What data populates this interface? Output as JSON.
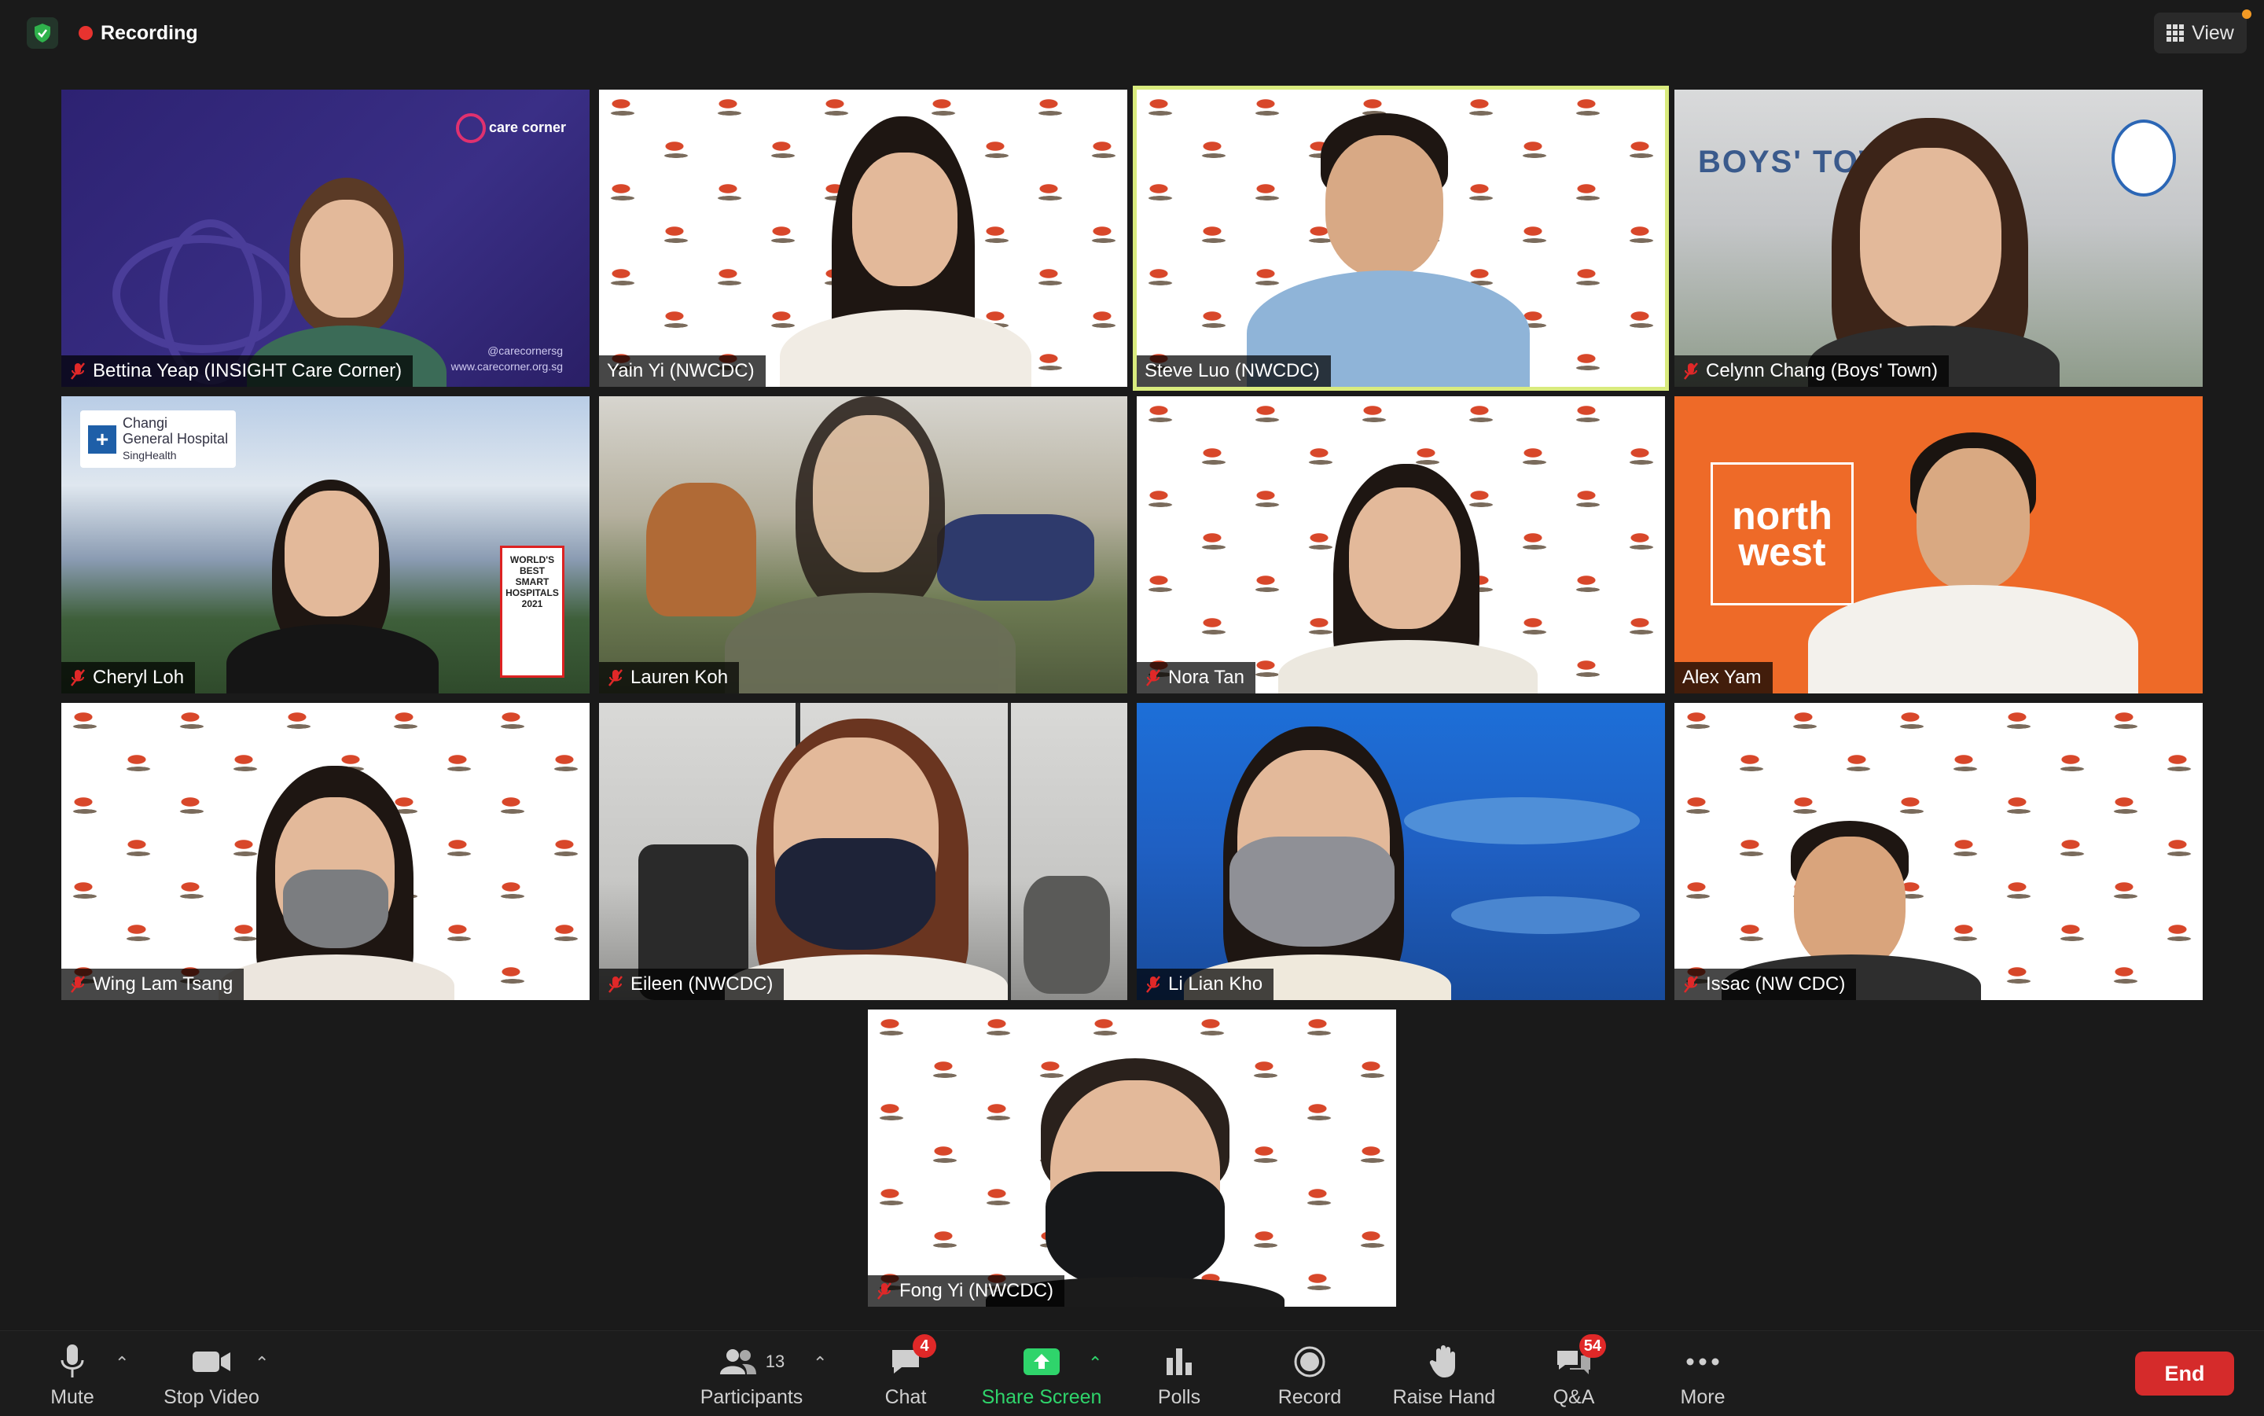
{
  "top_bar": {
    "recording_label": "Recording",
    "view_label": "View"
  },
  "participants_tiles": [
    {
      "name": "Bettina Yeap (INSIGHT Care Corner)",
      "muted": true
    },
    {
      "name": "Yain Yi (NWCDC)",
      "muted": false
    },
    {
      "name": "Steve Luo (NWCDC)",
      "muted": false,
      "active_speaker": true
    },
    {
      "name": "Celynn Chang (Boys' Town)",
      "muted": true
    },
    {
      "name": "Cheryl Loh",
      "muted": true
    },
    {
      "name": "Lauren Koh",
      "muted": true
    },
    {
      "name": "Nora Tan",
      "muted": true
    },
    {
      "name": "Alex Yam",
      "muted": false
    },
    {
      "name": "Wing Lam Tsang",
      "muted": true
    },
    {
      "name": "Eileen (NWCDC)",
      "muted": true
    },
    {
      "name": "Li Lian Kho",
      "muted": true
    },
    {
      "name": "Issac (NW CDC)",
      "muted": true
    },
    {
      "name": "Fong Yi (NWCDC)",
      "muted": true
    }
  ],
  "backgrounds": {
    "care_corner_logo": "care corner",
    "care_corner_social": "@carecornersg",
    "care_corner_url": "www.carecorner.org.sg",
    "northwest_logo_line1": "north",
    "northwest_logo_line2": "west",
    "changi_logo_line1": "Changi",
    "changi_logo_line2": "General Hospital",
    "changi_logo_line3": "SingHealth",
    "changi_badge": "WORLD'S BEST SMART HOSPITALS 2021",
    "boys_town_sign": "BOYS' TOWN"
  },
  "toolbar": {
    "mute_label": "Mute",
    "video_label": "Stop Video",
    "participants_label": "Participants",
    "participants_count": "13",
    "chat_label": "Chat",
    "chat_badge": "4",
    "share_label": "Share Screen",
    "polls_label": "Polls",
    "record_label": "Record",
    "raise_hand_label": "Raise Hand",
    "qa_label": "Q&A",
    "qa_badge": "54",
    "more_label": "More",
    "end_label": "End"
  },
  "colors": {
    "recording_dot": "#e8332f",
    "share_green": "#2fd46b",
    "end_red": "#d52b2b",
    "active_speaker_border": "#d9eb7e",
    "badge_red": "#e02828"
  }
}
